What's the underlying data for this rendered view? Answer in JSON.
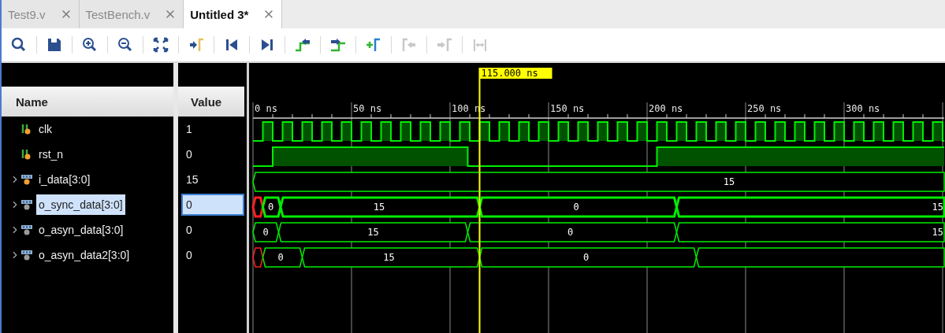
{
  "tabs": [
    {
      "label": "Test9.v",
      "selected": false
    },
    {
      "label": "TestBench.v",
      "selected": false
    },
    {
      "label": "Untitled 3*",
      "selected": true
    }
  ],
  "toolbar": [
    {
      "kind": "search",
      "disabled": false
    },
    {
      "kind": "save",
      "disabled": false
    },
    {
      "kind": "zoom-in",
      "disabled": false
    },
    {
      "kind": "zoom-out",
      "disabled": false
    },
    {
      "kind": "fit",
      "disabled": false
    },
    {
      "kind": "go-cursor",
      "disabled": false
    },
    {
      "kind": "go-start",
      "disabled": false
    },
    {
      "kind": "go-end",
      "disabled": false
    },
    {
      "kind": "prev-edge",
      "disabled": false
    },
    {
      "kind": "next-edge",
      "disabled": false
    },
    {
      "kind": "add-marker",
      "disabled": false
    },
    {
      "kind": "prev-marker",
      "disabled": true
    },
    {
      "kind": "next-marker",
      "disabled": true
    },
    {
      "kind": "swap-markers",
      "disabled": true
    }
  ],
  "columns": {
    "name": "Name",
    "value": "Value"
  },
  "signals": [
    {
      "name": "clk",
      "kind": "bit",
      "input": true,
      "value": "1",
      "selected": false
    },
    {
      "name": "rst_n",
      "kind": "bit",
      "input": true,
      "value": "0",
      "selected": false
    },
    {
      "name": "i_data[3:0]",
      "kind": "bus",
      "input": true,
      "expanded": false,
      "value": "15",
      "selected": false,
      "labels": [
        "15"
      ]
    },
    {
      "name": "o_sync_data[3:0]",
      "kind": "bus",
      "input": false,
      "expanded": false,
      "value": "0",
      "selected": true,
      "labels": [
        "0",
        "15",
        "0",
        "15"
      ]
    },
    {
      "name": "o_asyn_data[3:0]",
      "kind": "bus",
      "input": false,
      "expanded": false,
      "value": "0",
      "selected": false,
      "labels": [
        "0",
        "15",
        "0",
        "15"
      ]
    },
    {
      "name": "o_asyn_data2[3:0]",
      "kind": "bus",
      "input": false,
      "expanded": false,
      "value": "0",
      "selected": false,
      "labels": [
        "0",
        "15",
        "0"
      ]
    }
  ],
  "waveform": {
    "cursor": "115.000 ns",
    "ticks": [
      "0 ns",
      "50 ns",
      "100 ns",
      "150 ns",
      "200 ns",
      "250 ns",
      "300 ns"
    ]
  }
}
